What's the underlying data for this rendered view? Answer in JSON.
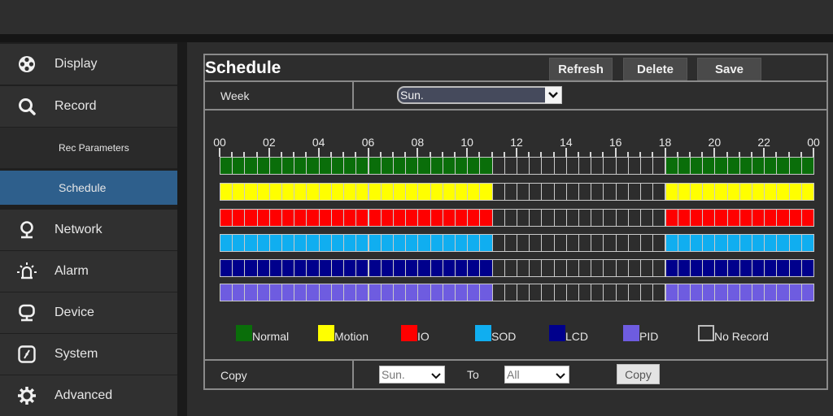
{
  "sidebar": {
    "items": [
      {
        "label": "Display",
        "icon": "film-reel-icon"
      },
      {
        "label": "Record",
        "icon": "search-icon"
      },
      {
        "label": "Network",
        "icon": "network-globe-icon"
      },
      {
        "label": "Alarm",
        "icon": "alarm-light-icon"
      },
      {
        "label": "Device",
        "icon": "monitor-icon"
      },
      {
        "label": "System",
        "icon": "system-gauge-icon"
      },
      {
        "label": "Advanced",
        "icon": "gear-icon"
      }
    ],
    "record_sub_items": [
      {
        "label": "Rec Parameters",
        "active": false
      },
      {
        "label": "Schedule",
        "active": true
      }
    ]
  },
  "panel": {
    "title": "Schedule",
    "buttons": {
      "refresh": "Refresh",
      "delete": "Delete",
      "save": "Save"
    },
    "week": {
      "label": "Week",
      "value": "Sun."
    },
    "copy": {
      "label": "Copy",
      "from_value": "Sun.",
      "to_label": "To",
      "to_value": "All",
      "button": "Copy"
    }
  },
  "schedule": {
    "hour_labels": [
      "00",
      "02",
      "04",
      "06",
      "08",
      "10",
      "12",
      "14",
      "16",
      "18",
      "20",
      "22",
      "00"
    ],
    "slots_per_day": 48,
    "slot_minutes": 30,
    "rows": [
      {
        "type": "Normal",
        "color": "#0a6e0a",
        "recorded_ranges": [
          [
            "00:00",
            "11:00"
          ],
          [
            "18:00",
            "24:00"
          ]
        ]
      },
      {
        "type": "Motion",
        "color": "#ffff00",
        "recorded_ranges": [
          [
            "00:00",
            "11:00"
          ],
          [
            "18:00",
            "24:00"
          ]
        ]
      },
      {
        "type": "IO",
        "color": "#ff0000",
        "recorded_ranges": [
          [
            "00:00",
            "11:00"
          ],
          [
            "18:00",
            "24:00"
          ]
        ]
      },
      {
        "type": "SOD",
        "color": "#10aef0",
        "recorded_ranges": [
          [
            "00:00",
            "11:00"
          ],
          [
            "18:00",
            "24:00"
          ]
        ]
      },
      {
        "type": "LCD",
        "color": "#00008c",
        "recorded_ranges": [
          [
            "00:00",
            "11:00"
          ],
          [
            "18:00",
            "24:00"
          ]
        ]
      },
      {
        "type": "PID",
        "color": "#6e5ce0",
        "recorded_ranges": [
          [
            "00:00",
            "11:00"
          ],
          [
            "18:00",
            "24:00"
          ]
        ]
      }
    ],
    "no_record_color": "#2d2d2d"
  },
  "legend": [
    {
      "label": "Normal",
      "color": "#0a6e0a"
    },
    {
      "label": "Motion",
      "color": "#ffff00"
    },
    {
      "label": "IO",
      "color": "#ff0000"
    },
    {
      "label": "SOD",
      "color": "#10aef0"
    },
    {
      "label": "LCD",
      "color": "#00008c"
    },
    {
      "label": "PID",
      "color": "#6e5ce0"
    },
    {
      "label": "No Record",
      "color": "#2d2d2d"
    }
  ]
}
